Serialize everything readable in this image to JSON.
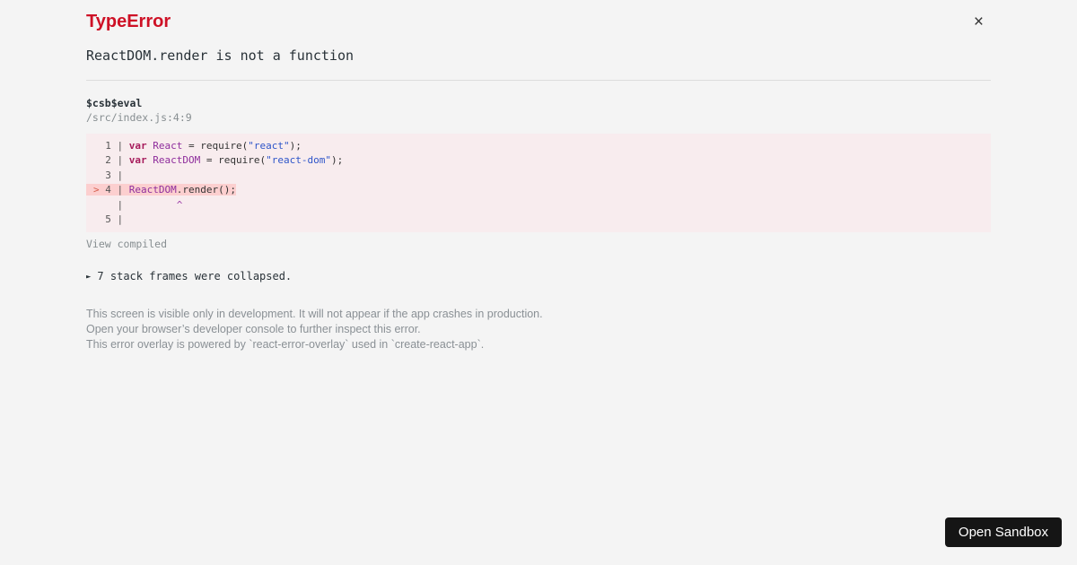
{
  "page": {
    "background": "#f4f4f4"
  },
  "header": {
    "title": "TypeError",
    "title_color": "#ce1126",
    "close_icon": "×",
    "message": "ReactDOM.render is not a function"
  },
  "stack_frame": {
    "function_name": "$csb$eval",
    "location": "/src/index.js:4:9",
    "view_toggle_label": "View compiled"
  },
  "code_frame": {
    "background": "#f8ecee",
    "highlight_background": "#fccfcf",
    "colors": {
      "gutter": "#555555",
      "plain": "#333333",
      "keyword": "#a71d5d",
      "capitalized": "#8e2d9c",
      "string": "#2e55c9",
      "marker": "#d6604f",
      "caret": "#9b3ba7"
    },
    "lines": [
      {
        "highlighted": false,
        "tokens": [
          [
            "gutter",
            "  1 | "
          ],
          [
            "keyword",
            "var"
          ],
          [
            "plain",
            " "
          ],
          [
            "capitalized",
            "React"
          ],
          [
            "plain",
            " = require("
          ],
          [
            "string",
            "\"react\""
          ],
          [
            "plain",
            ");"
          ]
        ]
      },
      {
        "highlighted": false,
        "tokens": [
          [
            "gutter",
            "  2 | "
          ],
          [
            "keyword",
            "var"
          ],
          [
            "plain",
            " "
          ],
          [
            "capitalized",
            "ReactDOM"
          ],
          [
            "plain",
            " = require("
          ],
          [
            "string",
            "\"react-dom\""
          ],
          [
            "plain",
            ");"
          ]
        ]
      },
      {
        "highlighted": false,
        "tokens": [
          [
            "gutter",
            "  3 | "
          ]
        ]
      },
      {
        "highlighted": true,
        "tokens": [
          [
            "marker",
            "> "
          ],
          [
            "gutter",
            "4 | "
          ],
          [
            "capitalized",
            "ReactDOM"
          ],
          [
            "plain",
            ".render();"
          ]
        ]
      },
      {
        "highlighted": false,
        "tokens": [
          [
            "gutter",
            "    | "
          ],
          [
            "plain",
            "        "
          ],
          [
            "caret",
            "^"
          ]
        ]
      },
      {
        "highlighted": false,
        "tokens": [
          [
            "gutter",
            "  5 | "
          ]
        ]
      }
    ]
  },
  "collapsed_frames": {
    "arrow_icon": "►",
    "label": "7 stack frames were collapsed."
  },
  "notes": [
    "This screen is visible only in development. It will not appear if the app crashes in production.",
    "Open your browser’s developer console to further inspect this error.",
    "This error overlay is powered by `react-error-overlay` used in `create-react-app`."
  ],
  "sandbox": {
    "open_button_label": "Open Sandbox",
    "button_background": "#151515",
    "button_text_color": "#ffffff"
  }
}
